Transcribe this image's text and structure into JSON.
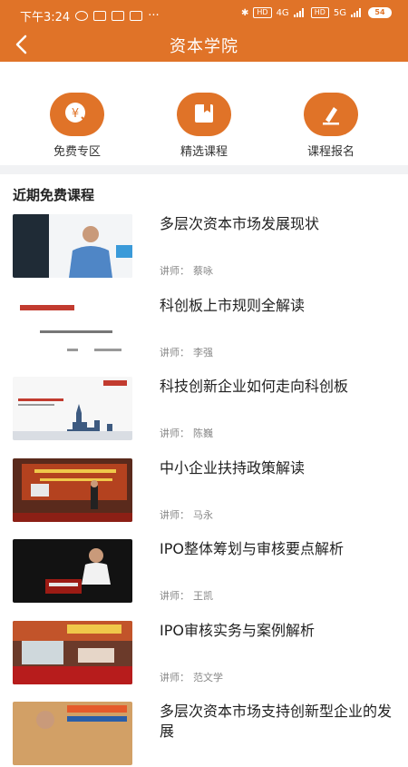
{
  "status_bar": {
    "time": "下午3:24",
    "dots": "···",
    "battery": "54",
    "net1": "HD",
    "net2": "4G",
    "net3": "HD",
    "net4": "5G"
  },
  "nav": {
    "title": "资本学院"
  },
  "quick_links": [
    {
      "label": "免费专区",
      "icon": "yen-check-icon"
    },
    {
      "label": "精选课程",
      "icon": "book-icon"
    },
    {
      "label": "课程报名",
      "icon": "edit-icon"
    }
  ],
  "section": {
    "title": "近期免费课程"
  },
  "courses": [
    {
      "title": "多层次资本市场发展现状",
      "lecturer_label": "讲师：",
      "lecturer": "蔡咏"
    },
    {
      "title": "科创板上市规则全解读",
      "lecturer_label": "讲师：",
      "lecturer": "李强"
    },
    {
      "title": "科技创新企业如何走向科创板",
      "lecturer_label": "讲师：",
      "lecturer": "陈巍"
    },
    {
      "title": "中小企业扶持政策解读",
      "lecturer_label": "讲师：",
      "lecturer": "马永"
    },
    {
      "title": "IPO整体筹划与审核要点解析",
      "lecturer_label": "讲师：",
      "lecturer": "王凯"
    },
    {
      "title": "IPO审核实务与案例解析",
      "lecturer_label": "讲师：",
      "lecturer": "范文学"
    },
    {
      "title": "多层次资本市场支持创新型企业的发展",
      "lecturer_label": "",
      "lecturer": ""
    }
  ],
  "colors": {
    "brand": "#e07328",
    "divider": "#f1f2f4"
  }
}
